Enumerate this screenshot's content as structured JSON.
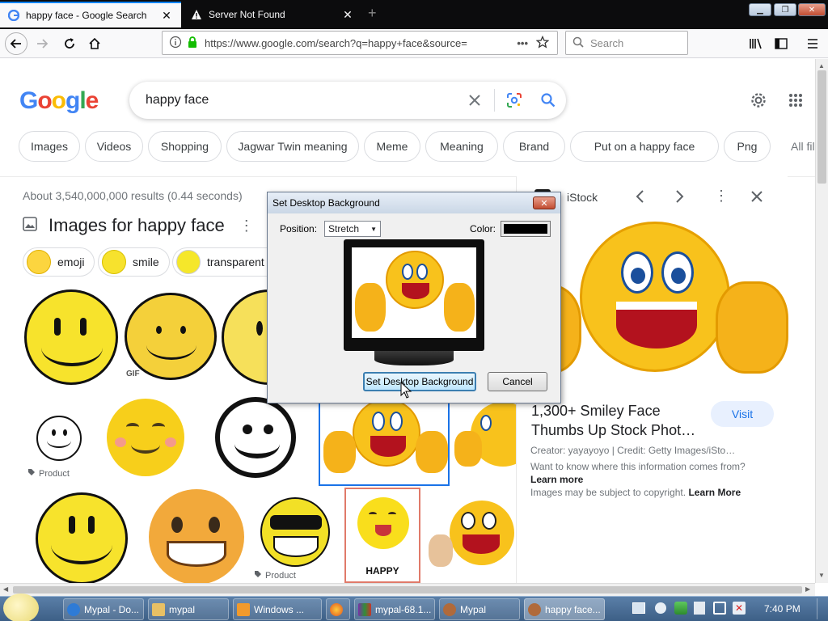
{
  "browser": {
    "tabs": [
      {
        "title": "happy face - Google Search",
        "active": true
      },
      {
        "title": "Server Not Found",
        "active": false
      }
    ],
    "url": "https://www.google.com/search?q=happy+face&source=",
    "search_placeholder": "Search"
  },
  "google": {
    "logo_text": "Google",
    "query": "happy face",
    "chips": [
      "Images",
      "Videos",
      "Shopping",
      "Jagwar Twin meaning",
      "Meme",
      "Meaning",
      "Brand",
      "Put on a happy face",
      "Png",
      "All fil"
    ],
    "results_count": "About 3,540,000,000 results (0.44 seconds)",
    "images_heading": "Images for happy face",
    "subchips": [
      "emoji",
      "smile",
      "transparent"
    ],
    "badges": {
      "gif": "GIF",
      "product": "Product",
      "happy": "HAPPY"
    }
  },
  "panel": {
    "source": "iStock",
    "title": "1,300+ Smiley Face Thumbs Up Stock Phot…",
    "visit": "Visit",
    "credit": "Creator: yayayoyo | Credit: Getty Images/iSto…",
    "info_question": "Want to know where this information comes from?",
    "learn_more": "Learn more",
    "copyright_text": "Images may be subject to copyright.",
    "copyright_link": "Learn More"
  },
  "dialog": {
    "title": "Set Desktop Background",
    "position_label": "Position:",
    "position_value": "Stretch",
    "color_label": "Color:",
    "color_value": "#000000",
    "ok_label": "Set Desktop Background",
    "cancel_label": "Cancel"
  },
  "taskbar": {
    "items": [
      {
        "label": "Mypal - Do..."
      },
      {
        "label": "mypal"
      },
      {
        "label": "Windows ..."
      },
      {
        "label": ""
      },
      {
        "label": "mypal-68.1..."
      },
      {
        "label": "Mypal"
      },
      {
        "label": "happy face..."
      }
    ],
    "clock": "7:40 PM"
  },
  "colors": {
    "google_blue": "#4285f4",
    "google_red": "#ea4335",
    "google_yellow": "#fbbc05",
    "google_green": "#34a853",
    "smiley_yellow": "#f5d218"
  }
}
